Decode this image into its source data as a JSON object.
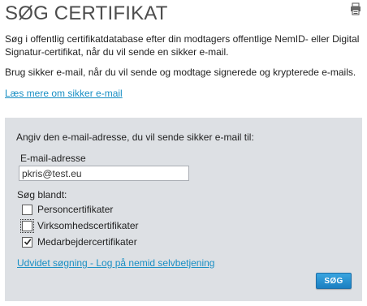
{
  "header": {
    "title": "SØG CERTIFIKAT",
    "print_icon": "printer-icon"
  },
  "intro": {
    "paragraph1": "Søg i offentlig certifikatdatabase efter din modtagers offentlige NemID- eller Digital Signatur-certifikat, når du vil sende en sikker e-mail.",
    "paragraph2": "Brug sikker e-mail, når du vil sende og modtage signerede og krypterede e-mails.",
    "read_more_link": "Læs mere om sikker e-mail"
  },
  "search_form": {
    "prompt": "Angiv den e-mail-adresse, du vil sende sikker e-mail til:",
    "email_label": "E-mail-adresse",
    "email_value": "pkris@test.eu",
    "search_among_label": "Søg blandt:",
    "options": [
      {
        "label": "Personcertifikater",
        "checked": false
      },
      {
        "label": "Virksomhedscertifikater",
        "checked": false
      },
      {
        "label": "Medarbejdercertifikater",
        "checked": true
      }
    ],
    "advanced_link": "Udvidet søgning - Log på nemid selvbetjening",
    "search_button": "SØG"
  },
  "colors": {
    "link": "#1a8fc4",
    "panel_background": "#dde0e4",
    "button": "#1a7fc1",
    "title": "#4d4d4d"
  }
}
